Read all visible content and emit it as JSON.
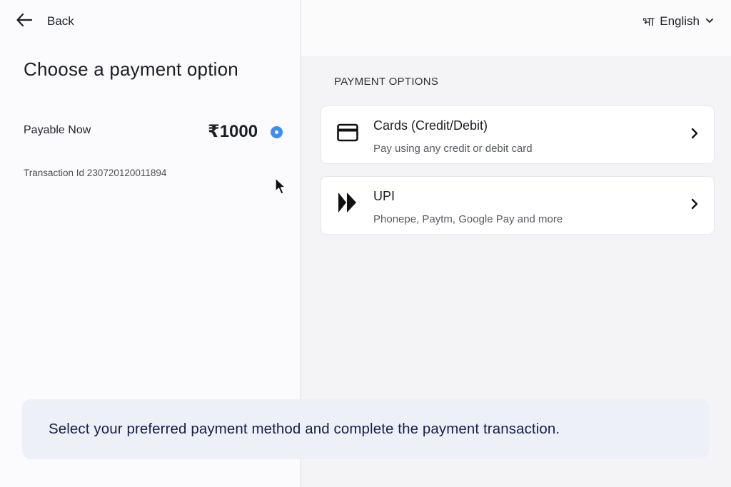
{
  "header": {
    "back_label": "Back",
    "language_glyph": "भा",
    "language_label": "English"
  },
  "left": {
    "title": "Choose a payment option",
    "payable_label": "Payable Now",
    "amount": "₹1000",
    "transaction_text": "Transaction Id 230720120011894"
  },
  "right": {
    "section_title": "PAYMENT OPTIONS",
    "options": [
      {
        "title": "Cards (Credit/Debit)",
        "subtitle": "Pay using any credit or debit card",
        "icon": "credit-card-icon"
      },
      {
        "title": "UPI",
        "subtitle": "Phonepe, Paytm, Google Pay and more",
        "icon": "upi-icon"
      }
    ]
  },
  "banner": {
    "text": "Select your preferred payment method and complete the payment transaction."
  },
  "colors": {
    "accent": "#3d8ef0",
    "banner_bg": "#edf0f7",
    "banner_text": "#15204a"
  }
}
